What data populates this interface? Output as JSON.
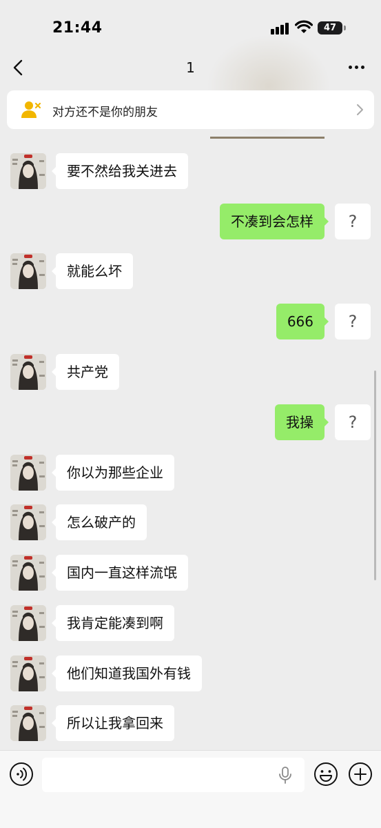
{
  "status_bar": {
    "time": "21:44",
    "battery": "47"
  },
  "nav": {
    "title": "1"
  },
  "notice": {
    "text": "对方还不是你的朋友"
  },
  "messages": [
    {
      "side": "left",
      "text": "要不然给我关进去"
    },
    {
      "side": "right",
      "text": "不凑到会怎样",
      "avatar_text": "?"
    },
    {
      "side": "left",
      "text": "就能么坏"
    },
    {
      "side": "right",
      "text": "666",
      "avatar_text": "?"
    },
    {
      "side": "left",
      "text": "共产党"
    },
    {
      "side": "right",
      "text": "我操",
      "avatar_text": "?"
    },
    {
      "side": "left",
      "text": "你以为那些企业"
    },
    {
      "side": "left",
      "text": "怎么破产的"
    },
    {
      "side": "left",
      "text": "国内一直这样流氓"
    },
    {
      "side": "left",
      "text": "我肯定能凑到啊"
    },
    {
      "side": "left",
      "text": "他们知道我国外有钱"
    },
    {
      "side": "left",
      "text": "所以让我拿回来"
    }
  ],
  "colors": {
    "background": "#ededed",
    "bubble_self": "#95ec69",
    "bubble_other": "#ffffff",
    "notice_icon": "#f2b600"
  },
  "icons": [
    "back-arrow-icon",
    "more-dots-icon",
    "stranger-user-icon",
    "chevron-right-icon",
    "voice-icon",
    "microphone-icon",
    "emoji-icon",
    "plus-icon"
  ]
}
